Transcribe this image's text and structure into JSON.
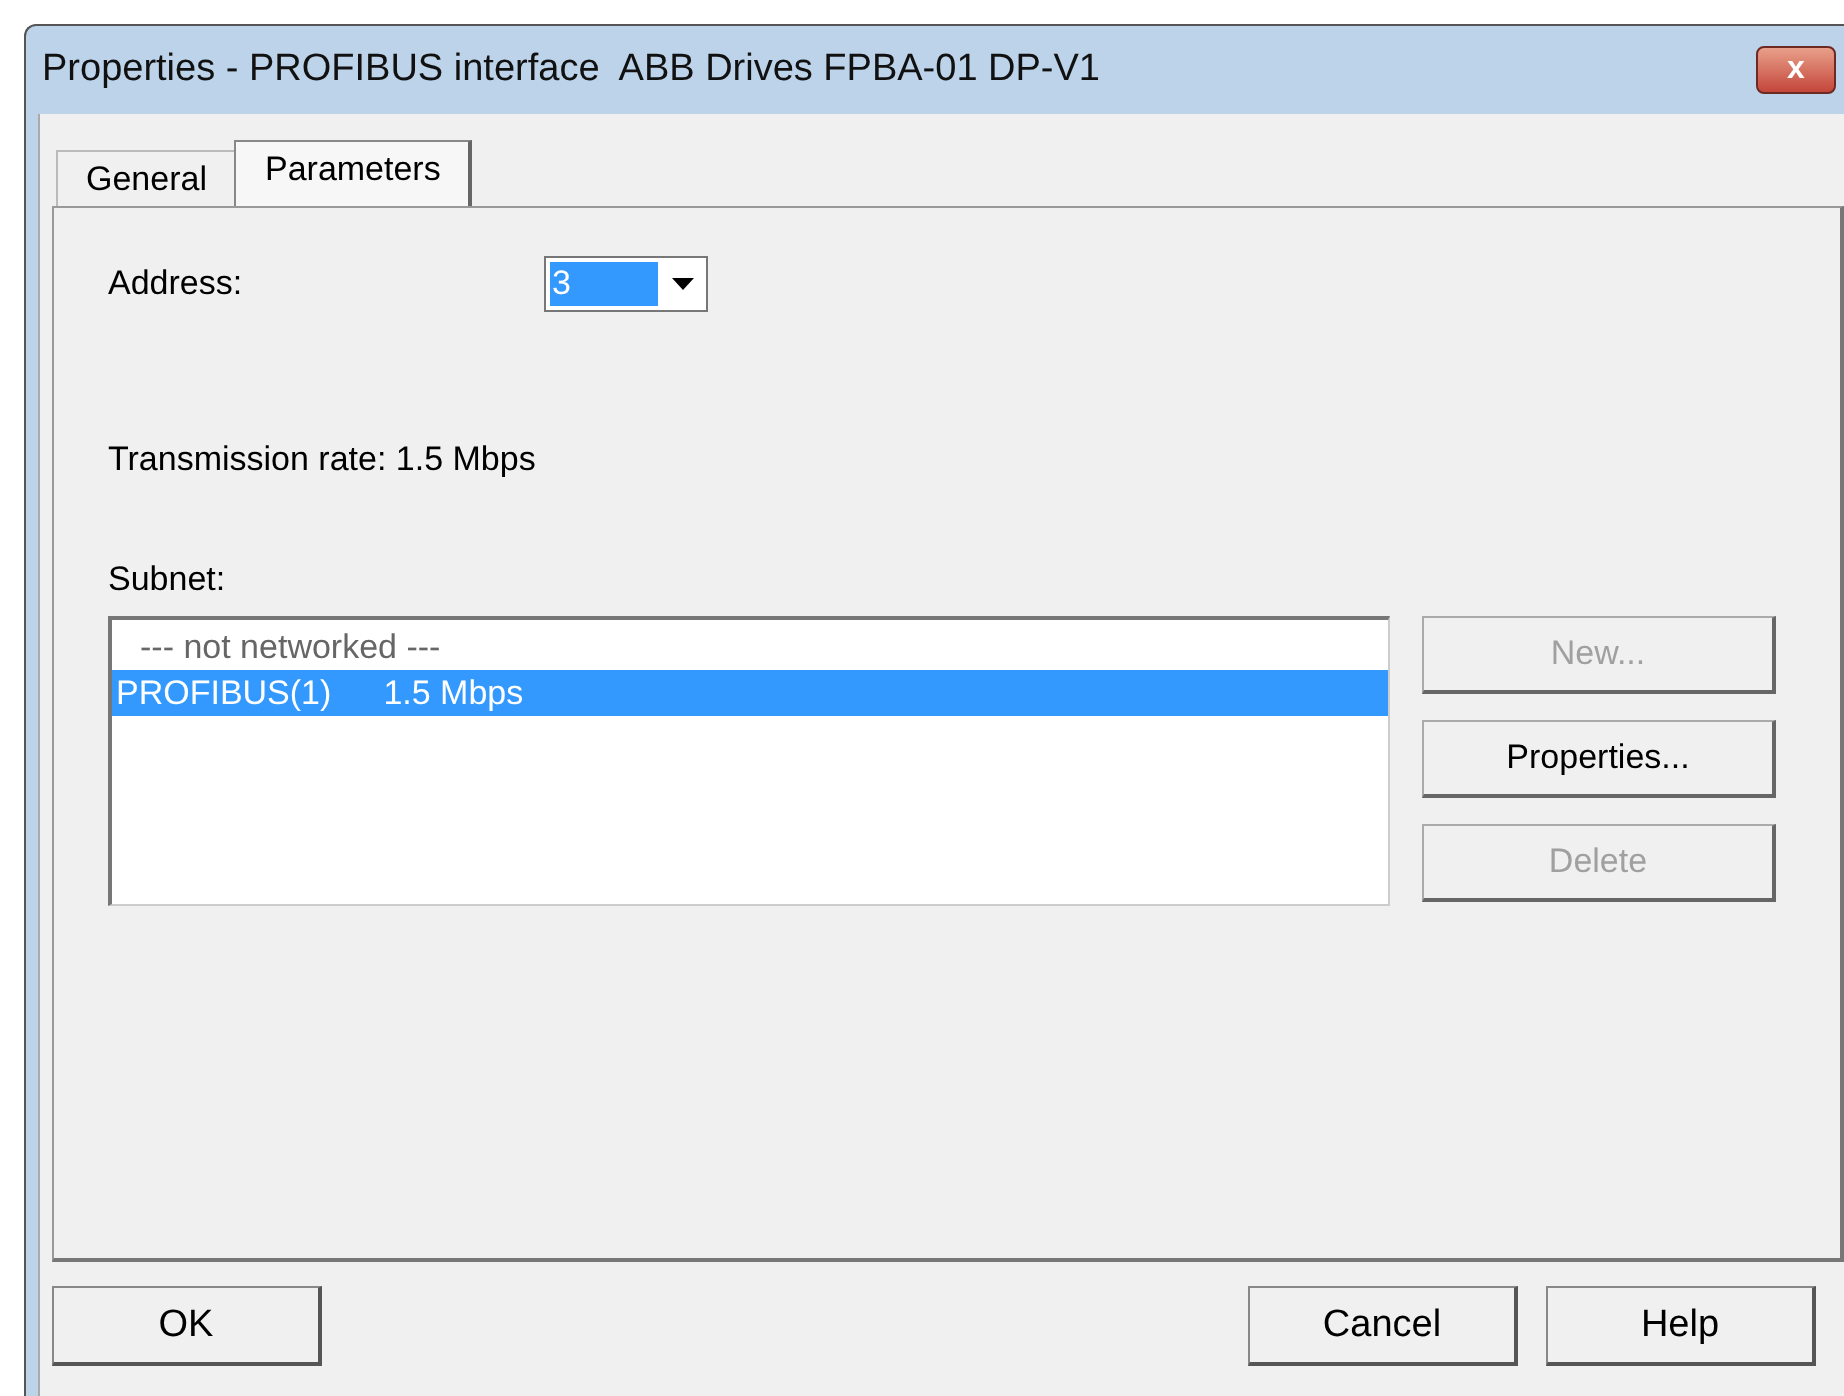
{
  "window": {
    "title": "Properties - PROFIBUS interface  ABB Drives FPBA-01 DP-V1",
    "close": "x"
  },
  "tabs": [
    {
      "label": "General",
      "selected": false
    },
    {
      "label": "Parameters",
      "selected": true
    }
  ],
  "address": {
    "label": "Address:",
    "value": "3"
  },
  "transmission_rate": "Transmission rate: 1.5 Mbps",
  "subnet": {
    "label": "Subnet:",
    "items": [
      {
        "name": "--- not networked ---",
        "kind": "placeholder",
        "selected": false
      },
      {
        "name": "PROFIBUS(1)",
        "rate": "1.5 Mbps",
        "kind": "network",
        "selected": true
      }
    ]
  },
  "side_buttons": [
    {
      "label": "New...",
      "disabled": true
    },
    {
      "label": "Properties...",
      "disabled": false
    },
    {
      "label": "Delete",
      "disabled": true
    }
  ],
  "footer": {
    "left_buttons": [
      "OK"
    ],
    "right_buttons": [
      "Cancel",
      "Help"
    ]
  }
}
